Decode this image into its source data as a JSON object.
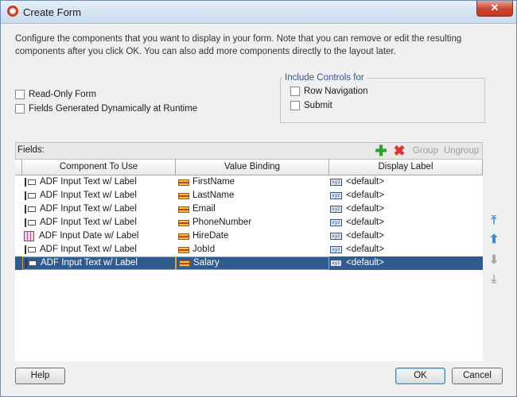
{
  "window": {
    "title": "Create Form",
    "close_label": "✕"
  },
  "intro_text": "Configure the components that you want to display in your form. Note that you can remove or edit the resulting components after you click OK. You can also add more components directly to the layout later.",
  "options": {
    "read_only": {
      "label": "Read-Only Form",
      "checked": false
    },
    "fields_dynamic": {
      "label": "Fields Generated Dynamically at Runtime",
      "checked": false
    }
  },
  "include_controls": {
    "legend": "Include Controls for",
    "row_navigation": {
      "label": "Row Navigation",
      "checked": false
    },
    "submit": {
      "label": "Submit",
      "checked": false
    }
  },
  "fields": {
    "header": "Fields:",
    "toolbar": {
      "group": "Group",
      "ungroup": "Ungroup"
    },
    "columns": [
      "Component To Use",
      "Value Binding",
      "Display Label"
    ],
    "rows": [
      {
        "component": "ADF Input Text w/ Label",
        "binding": "FirstName",
        "label": "<default>",
        "icon": "input-text-icon"
      },
      {
        "component": "ADF Input Text w/ Label",
        "binding": "LastName",
        "label": "<default>",
        "icon": "input-text-icon"
      },
      {
        "component": "ADF Input Text w/ Label",
        "binding": "Email",
        "label": "<default>",
        "icon": "input-text-icon"
      },
      {
        "component": "ADF Input Text w/ Label",
        "binding": "PhoneNumber",
        "label": "<default>",
        "icon": "input-text-icon"
      },
      {
        "component": "ADF Input Date w/ Label",
        "binding": "HireDate",
        "label": "<default>",
        "icon": "input-date-icon"
      },
      {
        "component": "ADF Input Text w/ Label",
        "binding": "JobId",
        "label": "<default>",
        "icon": "input-text-icon"
      },
      {
        "component": "ADF Input Text w/ Label",
        "binding": "Salary",
        "label": "<default>",
        "icon": "input-text-icon",
        "selected": true
      }
    ],
    "label_badge": "xyz"
  },
  "buttons": {
    "help": "Help",
    "ok": "OK",
    "cancel": "Cancel"
  },
  "colors": {
    "selection": "#2f5b8e",
    "add": "#2ea02e",
    "delete": "#d9362b",
    "arrow_active": "#3c8ed8",
    "arrow_disabled": "#a8a8a8"
  }
}
